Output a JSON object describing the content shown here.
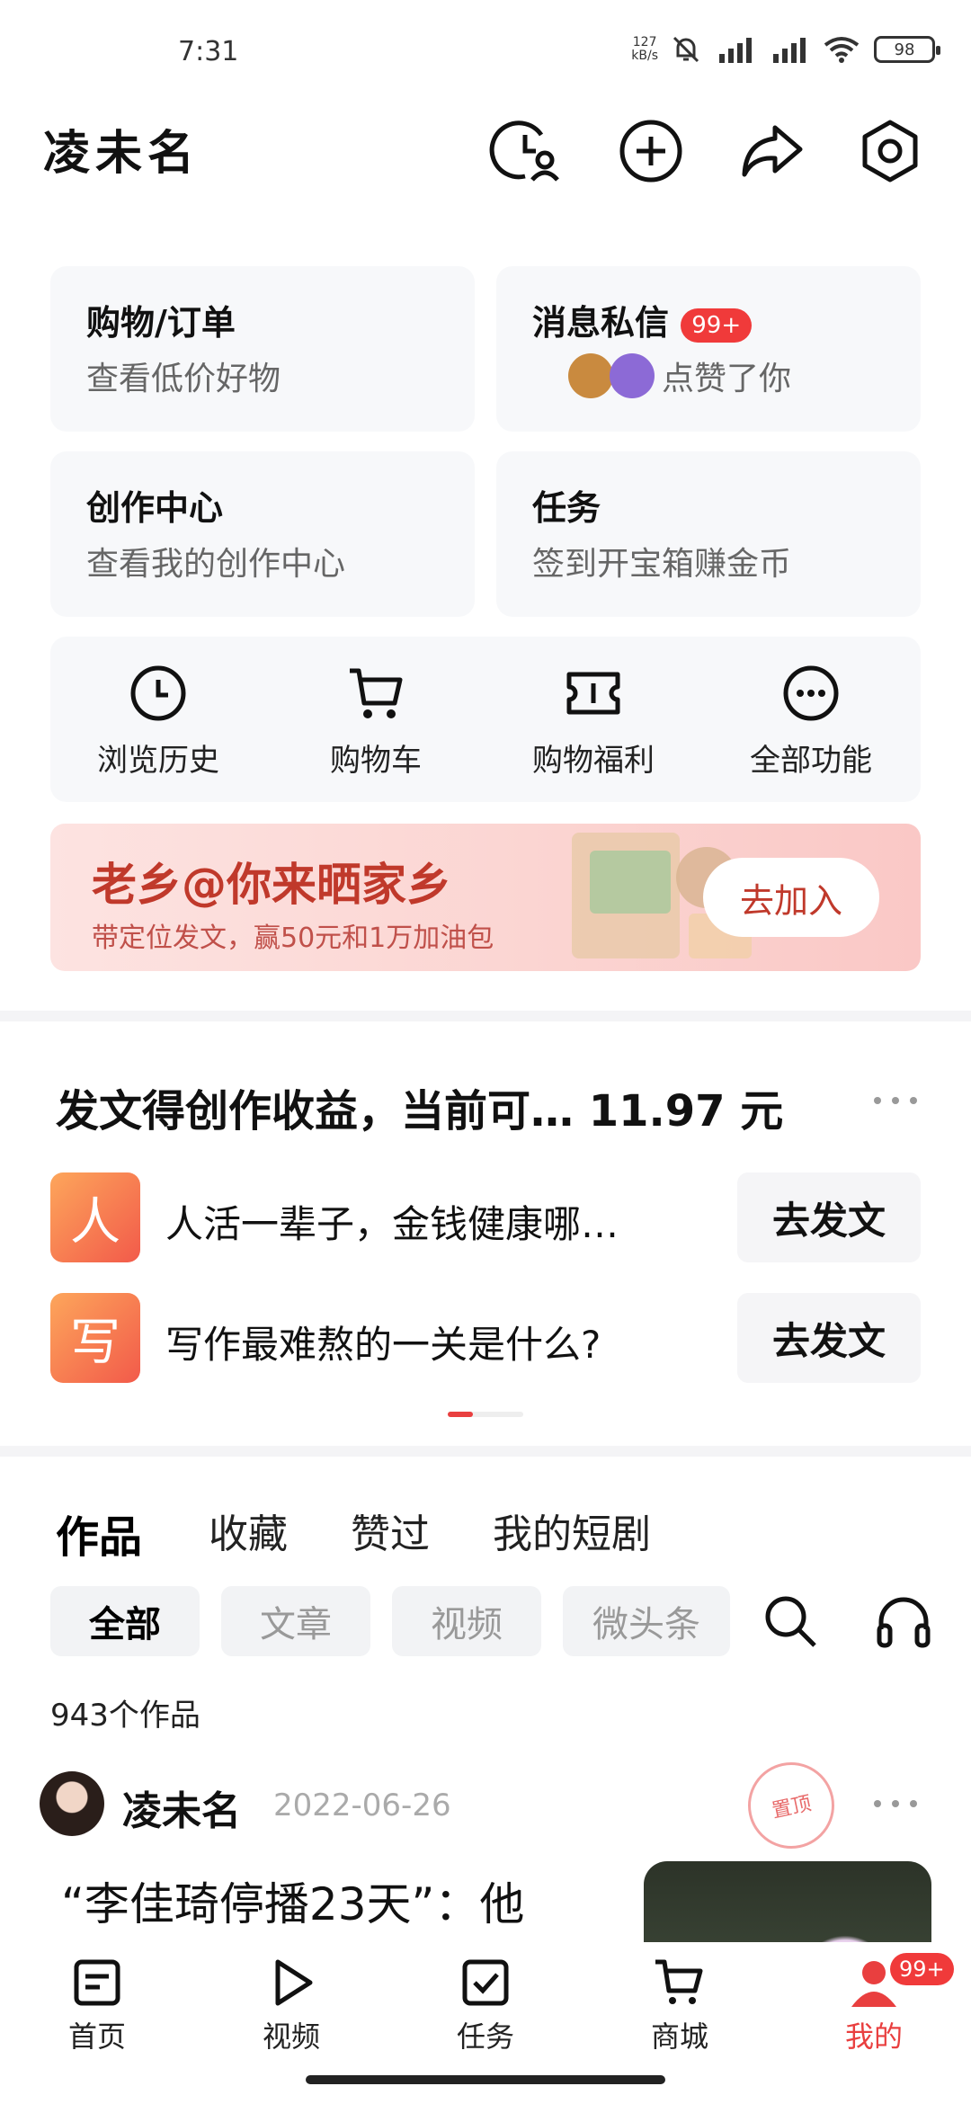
{
  "status": {
    "time": "7:31",
    "net_speed_value": "127",
    "net_speed_unit": "kB/s",
    "battery": "98"
  },
  "header": {
    "username": "凌未名"
  },
  "cards": {
    "orders": {
      "title": "购物/订单",
      "subtitle": "查看低价好物"
    },
    "messages": {
      "title": "消息私信",
      "badge": "99+",
      "subtitle": "点赞了你"
    },
    "creator": {
      "title": "创作中心",
      "subtitle": "查看我的创作中心"
    },
    "tasks": {
      "title": "任务",
      "subtitle": "签到开宝箱赚金币"
    }
  },
  "quick": [
    {
      "label": "浏览历史",
      "icon": "clock-icon"
    },
    {
      "label": "购物车",
      "icon": "cart-icon"
    },
    {
      "label": "购物福利",
      "icon": "ticket-icon"
    },
    {
      "label": "全部功能",
      "icon": "more-circle-icon"
    }
  ],
  "banner": {
    "title": "老乡@你来晒家乡",
    "subtitle": "带定位发文，赢50元和1万加油包",
    "button": "去加入"
  },
  "earn": {
    "title": "发文得创作收益，当前可… 11.97 元",
    "posts": [
      {
        "icon_text": "人",
        "text": "人活一辈子，金钱健康哪…",
        "button": "去发文"
      },
      {
        "icon_text": "写",
        "text": "写作最难熬的一关是什么?",
        "button": "去发文"
      }
    ]
  },
  "tabs": [
    "作品",
    "收藏",
    "赞过",
    "我的短剧"
  ],
  "filters": [
    "全部",
    "文章",
    "视频",
    "微头条"
  ],
  "works": {
    "count": "943个作品"
  },
  "post": {
    "author": "凌未名",
    "date": "2022-06-26",
    "stamp": "置顶",
    "title": "“李佳琦停播23天”：他"
  },
  "bottom_nav": [
    {
      "label": "首页",
      "icon": "home-doc-icon"
    },
    {
      "label": "视频",
      "icon": "play-icon"
    },
    {
      "label": "任务",
      "icon": "task-check-icon"
    },
    {
      "label": "商城",
      "icon": "cart-icon"
    },
    {
      "label": "我的",
      "icon": "user-icon",
      "badge": "99+"
    }
  ],
  "colors": {
    "accent": "#e93f3f",
    "card_bg": "#f7f8fa"
  }
}
